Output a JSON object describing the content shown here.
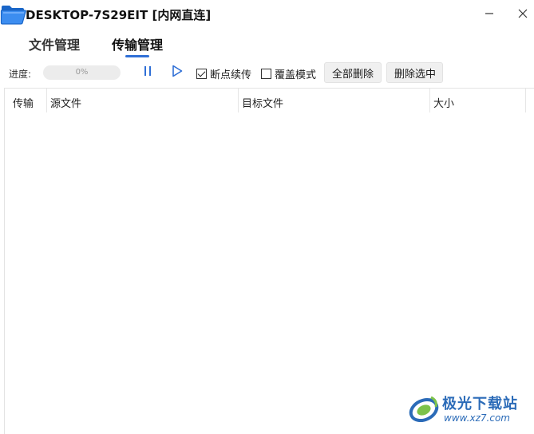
{
  "window": {
    "title": "DESKTOP-7S29EIT [内网直连]"
  },
  "tabs": [
    {
      "label": "文件管理",
      "active": false
    },
    {
      "label": "传输管理",
      "active": true
    }
  ],
  "toolbar": {
    "progress_label": "进度:",
    "progress_text": "0%",
    "progress_value": 0,
    "resume_label": "断点续传",
    "resume_checked": true,
    "overwrite_label": "覆盖模式",
    "overwrite_checked": false,
    "delete_all_label": "全部删除",
    "delete_selected_label": "删除选中"
  },
  "table": {
    "columns": [
      "传输",
      "源文件",
      "目标文件",
      "大小"
    ],
    "rows": []
  },
  "watermark": {
    "text": "极光下载站",
    "url": "www.xz7.com"
  },
  "colors": {
    "accent": "#2f6fd6",
    "watermark": "#2b6bb8"
  },
  "icons": {
    "app": "folder-icon",
    "minimize": "minimize-icon",
    "close": "close-icon",
    "pause": "pause-icon",
    "play": "play-icon"
  }
}
